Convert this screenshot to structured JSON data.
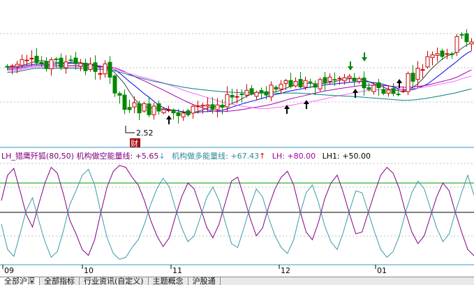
{
  "colors": {
    "up": "#cc0000",
    "down": "#008800",
    "ma_dark": "#404040",
    "ma_blue": "#0000ee",
    "ma_purple": "#aa00aa",
    "ma_pink": "#ff66ff",
    "ma_teal": "#008080",
    "grid": "#bfbfbf",
    "osc_purple": "#800080",
    "osc_teal": "#3a9aa8",
    "line_upper": "#009900",
    "line_lower": "#000000",
    "finance_badge_bg": "#a01010",
    "finance_badge_text": "#ffffff"
  },
  "indicator": {
    "name": "LH_猎鹰歼狐(80,50)",
    "short_label": "机构做空能量线:",
    "short_value": "+5.65",
    "short_arrow": "↓",
    "long_label": "机构做多能量线:",
    "long_value": "+67.43",
    "long_arrow": "↑",
    "lh_label": "LH:",
    "lh_value": "+80.00",
    "lh1_label": "LH1:",
    "lh1_value": "+50.00"
  },
  "annotations": {
    "low_price": "2.52",
    "finance_badge": "财"
  },
  "tabs": [
    {
      "label": "全部沪深",
      "active": true
    },
    {
      "label": "全部指标",
      "active": false
    },
    {
      "label": "行业资讯(自定义)",
      "active": false
    },
    {
      "label": "主题概念",
      "active": false
    },
    {
      "label": "沪股通",
      "active": false
    }
  ],
  "chart_data": {
    "type": "candlestick",
    "x_axis_labels": [
      "09",
      "10",
      "11",
      "12",
      "01"
    ],
    "price_low_marked": 2.52,
    "buy_signal_count": 5,
    "sell_signal_count": 2,
    "indicator_levels": {
      "LH": 80,
      "LH1": 50
    },
    "indicator_latest": {
      "short_energy": 5.65,
      "long_energy": 67.43
    },
    "series": [
      {
        "name": "机构做空能量线",
        "values": [
          62,
          88,
          95,
          72,
          48,
          35,
          58,
          80,
          96,
          90,
          68,
          42,
          28,
          12,
          6,
          22,
          50,
          76,
          92,
          98,
          96,
          86,
          78,
          62,
          42,
          26,
          15,
          24,
          46,
          66,
          80,
          74,
          55,
          35,
          24,
          38,
          60,
          82,
          86,
          66,
          44,
          26,
          34,
          56,
          74,
          86,
          92,
          78,
          52,
          30,
          22,
          40,
          64,
          80,
          88,
          70,
          48,
          28,
          30,
          50,
          70,
          88,
          96,
          90,
          74,
          50,
          30,
          18,
          26,
          46,
          66,
          80,
          72,
          50,
          30,
          12,
          5.65
        ]
      },
      {
        "name": "机构做多能量线",
        "values": [
          38,
          12,
          5,
          28,
          52,
          65,
          42,
          20,
          4,
          10,
          32,
          58,
          72,
          88,
          94,
          78,
          50,
          24,
          8,
          2,
          4,
          14,
          22,
          38,
          58,
          74,
          85,
          76,
          54,
          34,
          20,
          26,
          45,
          65,
          76,
          62,
          40,
          18,
          14,
          34,
          56,
          74,
          66,
          44,
          26,
          14,
          8,
          22,
          48,
          70,
          78,
          60,
          36,
          20,
          12,
          30,
          52,
          72,
          70,
          50,
          30,
          12,
          4,
          10,
          26,
          50,
          70,
          82,
          74,
          54,
          34,
          20,
          28,
          50,
          70,
          88,
          67.43
        ]
      }
    ]
  }
}
